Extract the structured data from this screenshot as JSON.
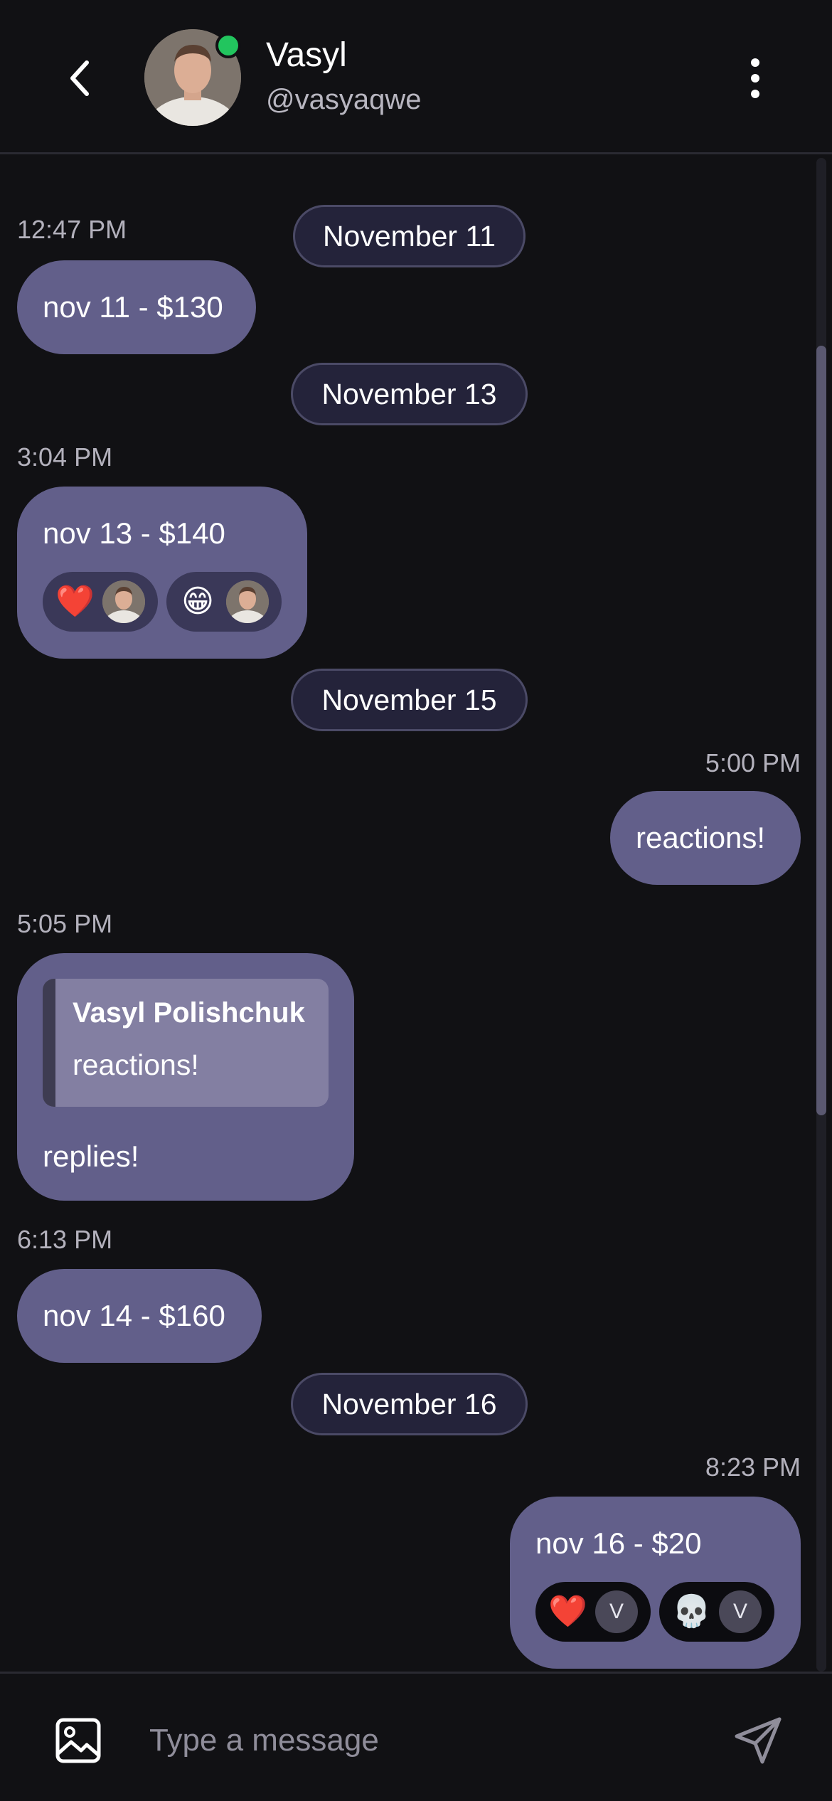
{
  "header": {
    "name": "Vasyl",
    "handle": "@vasyaqwe",
    "online_color": "#22c55e"
  },
  "dates": {
    "d1": "November 11",
    "d2": "November 13",
    "d3": "November 15",
    "d4": "November 16"
  },
  "messages": [
    {
      "time": "12:47 PM",
      "text": "nov 11 - $130",
      "side": "left"
    },
    {
      "time": "3:04 PM",
      "text": "nov 13 - $140",
      "side": "left",
      "reactions": [
        {
          "emoji": "❤️",
          "by": "avatar"
        },
        {
          "emoji": "😁",
          "by": "avatar"
        }
      ]
    },
    {
      "time": "5:00 PM",
      "text": "reactions!",
      "side": "right"
    },
    {
      "time": "5:05 PM",
      "text": "replies!",
      "side": "left",
      "reply_to": {
        "author": "Vasyl Polishchuk",
        "text": "reactions!"
      }
    },
    {
      "time": "6:13 PM",
      "text": "nov 14 - $160",
      "side": "left"
    },
    {
      "time": "8:23 PM",
      "text": "nov 16 - $20",
      "side": "right",
      "reactions": [
        {
          "emoji": "❤️",
          "by": "V"
        },
        {
          "emoji": "💀",
          "by": "V"
        }
      ]
    }
  ],
  "composer": {
    "placeholder": "Type a message"
  },
  "colors": {
    "background": "#111114",
    "bubble": "#625f8a",
    "date_pill": "#24233a",
    "quote": "#837fa2"
  }
}
